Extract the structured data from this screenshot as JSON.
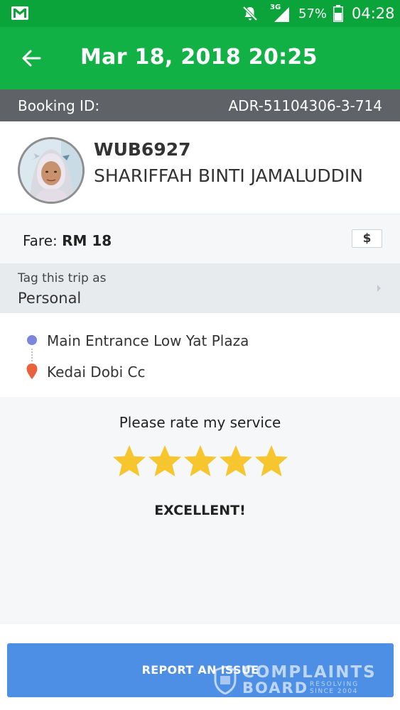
{
  "status_bar": {
    "network_label": "3G",
    "battery_percent": "57%",
    "battery_level": 0.57,
    "time": "04:28",
    "icons": [
      "gmail-icon",
      "mute-icon",
      "signal-icon",
      "battery-icon"
    ]
  },
  "app_bar": {
    "title": "Mar 18, 2018 20:25",
    "back_icon": "arrow-left-icon"
  },
  "booking": {
    "label": "Booking ID:",
    "id": "ADR-51104306-3-714"
  },
  "driver": {
    "plate": "WUB6927",
    "name": "SHARIFFAH BINTI JAMALUDDIN"
  },
  "fare": {
    "label": "Fare: ",
    "amount": "RM 18",
    "button_icon": "$"
  },
  "tag": {
    "caption": "Tag this trip as",
    "value": "Personal"
  },
  "route": {
    "pickup": "Main Entrance Low Yat Plaza",
    "dropoff": "Kedai Dobi Cc"
  },
  "rating": {
    "prompt": "Please rate my service",
    "stars": 5,
    "max_stars": 5,
    "verdict": "EXCELLENT!"
  },
  "report_button": {
    "label": "REPORT AN ISSUE"
  },
  "watermark": {
    "line1": "COMPLAINTS",
    "line2": "BOARD",
    "tag1": "RESOLVING",
    "tag2": "SINCE 2004"
  },
  "colors": {
    "status_bar": "#0ba43a",
    "app_bar": "#12b145",
    "booking_bar": "#5f6368",
    "report_button": "#4e8fe6",
    "star": "#f7c52d",
    "pickup_dot": "#7b86dd",
    "dropoff_pin": "#e8623d"
  }
}
